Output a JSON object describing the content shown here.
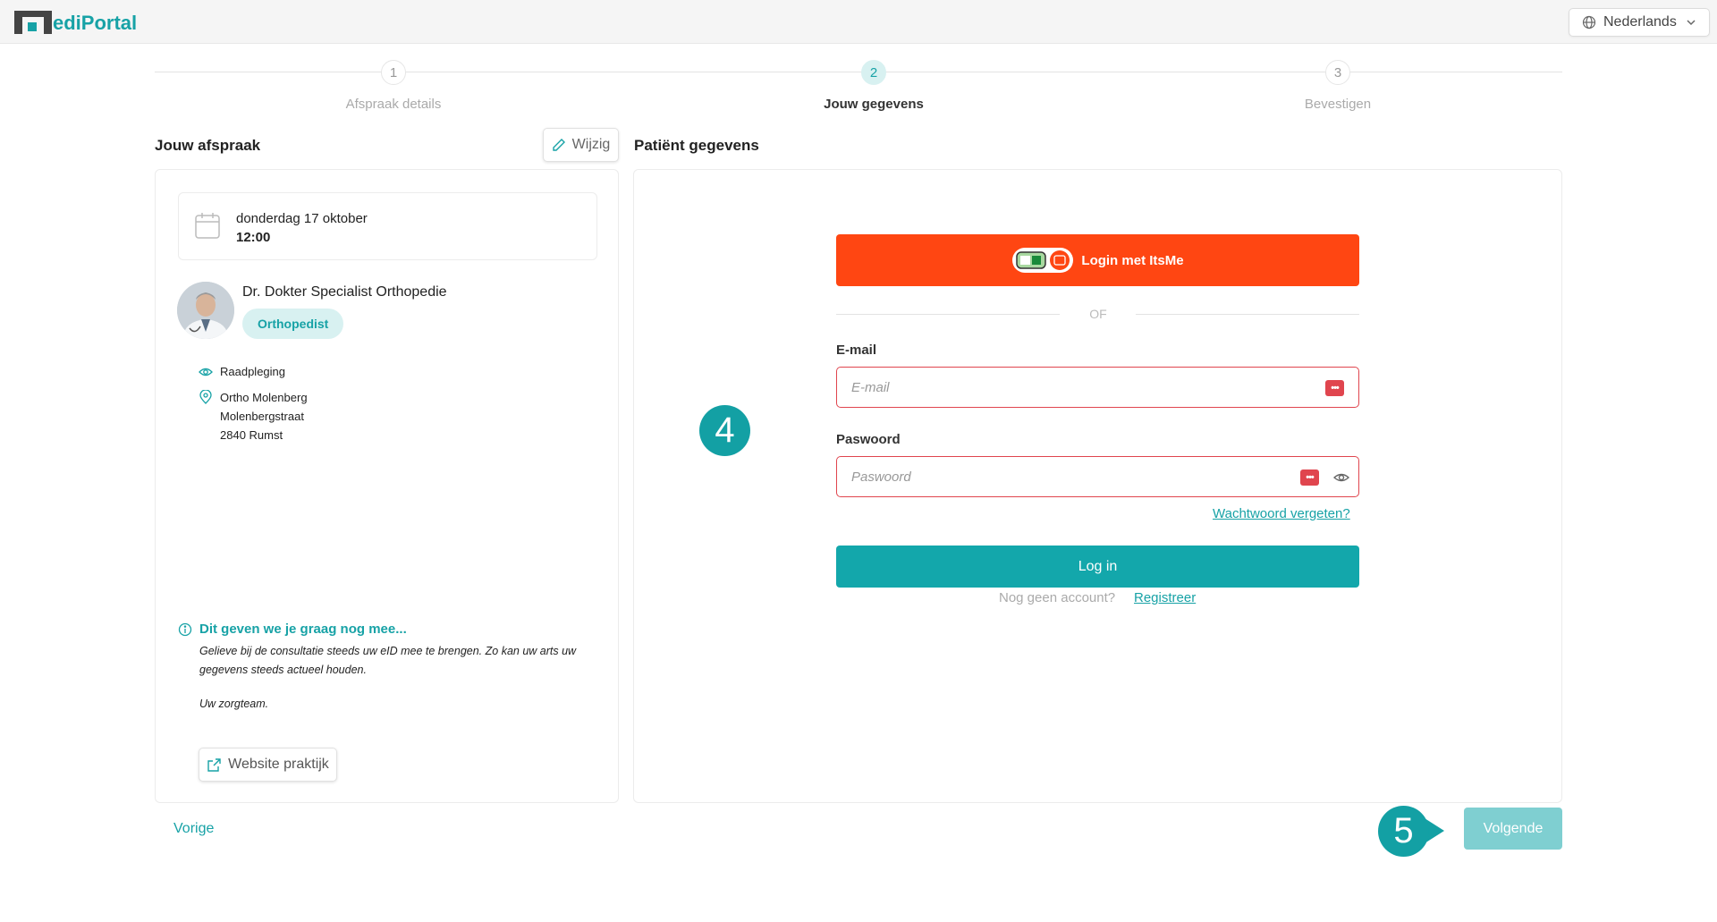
{
  "app": {
    "logo_text": "ediPortal",
    "language": "Nederlands"
  },
  "stepper": {
    "steps": [
      {
        "number": "1",
        "label": "Afspraak details",
        "active": false
      },
      {
        "number": "2",
        "label": "Jouw gegevens",
        "active": true
      },
      {
        "number": "3",
        "label": "Bevestigen",
        "active": false
      }
    ]
  },
  "appointment": {
    "title": "Jouw afspraak",
    "edit_label": "Wijzig",
    "date": "donderdag 17 oktober",
    "time": "12:00",
    "doctor_name": "Dr. Dokter Specialist Orthopedie",
    "specialty": "Orthopedist",
    "type": "Raadpleging",
    "location_name": "Ortho Molenberg",
    "location_street": "Molenbergstraat",
    "location_city": "2840 Rumst",
    "note_title": "Dit geven we je graag nog mee...",
    "note_text": "Gelieve bij de consultatie steeds uw eID mee te brengen. Zo kan uw arts uw gegevens steeds actueel houden.",
    "note_sign": "Uw zorgteam.",
    "website_label": "Website praktijk"
  },
  "patient": {
    "title": "Patiënt gegevens",
    "itsme_label": "Login met ItsMe",
    "or_label": "OF",
    "email_label": "E-mail",
    "email_placeholder": "E-mail",
    "email_value": "",
    "password_label": "Paswoord",
    "password_placeholder": "Paswoord",
    "password_value": "",
    "forgot_label": "Wachtwoord vergeten?",
    "login_label": "Log in",
    "no_account_label": "Nog geen account?",
    "register_label": "Registreer"
  },
  "annotations": {
    "badge_4": "4",
    "badge_5": "5"
  },
  "nav": {
    "prev_label": "Vorige",
    "next_label": "Volgende"
  },
  "colors": {
    "brand": "#17a2a6",
    "itsme": "#ff4612",
    "error": "#e0454e",
    "next_disabled": "#7fcfd1"
  }
}
